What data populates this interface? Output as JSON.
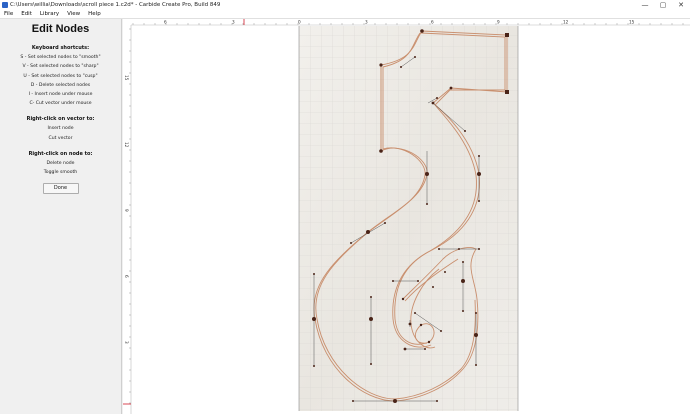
{
  "window": {
    "title": "C:\\Users\\willia\\Downloads\\scroll piece 1.c2d* - Carbide Create Pro, Build 849",
    "minimize_glyph": "—",
    "maximize_glyph": "▢",
    "close_glyph": "✕"
  },
  "menu": [
    {
      "label": "File"
    },
    {
      "label": "Edit"
    },
    {
      "label": "Library"
    },
    {
      "label": "View"
    },
    {
      "label": "Help"
    }
  ],
  "panel": {
    "title": "Edit Nodes",
    "keyboard_heading": "Keyboard shortcuts:",
    "shortcuts": [
      "S - Set selected nodes to \"smooth\"",
      "V - Set selected nodes to \"sharp\"",
      "U - Set selected nodes to \"cusp\"",
      "D - Delete selected nodes",
      "I - Insert node under mouse",
      "C- Cut vector under mouse"
    ],
    "vector_heading": "Right-click on vector to:",
    "vector_actions": [
      "Insert node",
      "Cut vector"
    ],
    "node_heading": "Right-click on node to:",
    "node_actions": [
      "Delete node",
      "Toggle smooth"
    ],
    "done_label": "Done"
  },
  "ruler": {
    "top_labels": [
      "6",
      "3",
      "0",
      "3",
      "6",
      "9",
      "12",
      "15"
    ],
    "left_labels": [
      "15",
      "12",
      "9",
      "6",
      "3"
    ]
  },
  "colors": {
    "path": "#c98f6e",
    "node": "#4a2418",
    "grid": "#dcdcdc",
    "material": "#ebe8e2",
    "ruler_mark": "#d11a2a"
  }
}
